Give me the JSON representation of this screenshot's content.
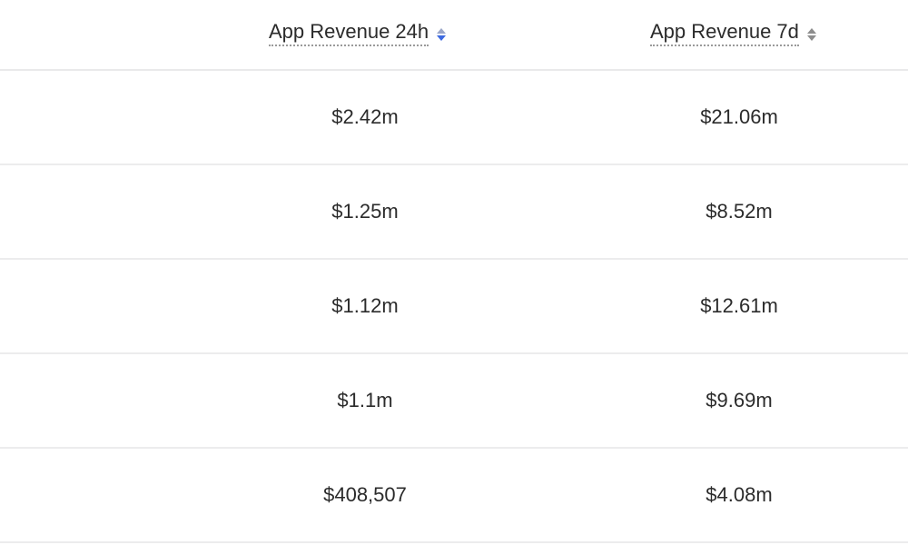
{
  "columns": [
    {
      "label": "App Revenue 24h",
      "sort_icon": "sort-active-icon",
      "sort_up_color": "#9aa6c8",
      "sort_down_color": "#3d6ae0"
    },
    {
      "label": "App Revenue 7d",
      "sort_icon": "sort-icon",
      "sort_up_color": "#8d8d8d",
      "sort_down_color": "#8d8d8d"
    }
  ],
  "rows": [
    {
      "revenue_24h": "$2.42m",
      "revenue_7d": "$21.06m"
    },
    {
      "revenue_24h": "$1.25m",
      "revenue_7d": "$8.52m"
    },
    {
      "revenue_24h": "$1.12m",
      "revenue_7d": "$12.61m"
    },
    {
      "revenue_24h": "$1.1m",
      "revenue_7d": "$9.69m"
    },
    {
      "revenue_24h": "$408,507",
      "revenue_7d": "$4.08m"
    }
  ]
}
